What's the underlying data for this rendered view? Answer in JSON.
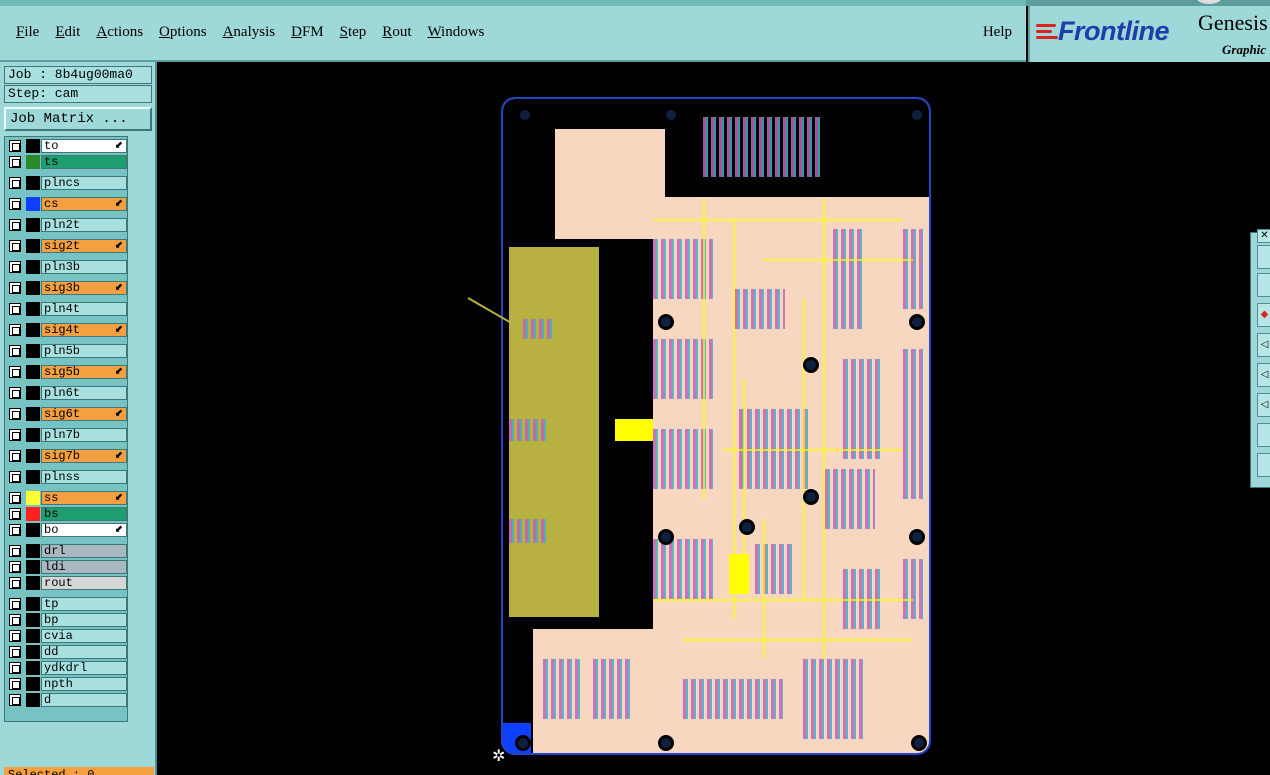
{
  "menu": {
    "items": [
      {
        "label": "File",
        "ul": "F",
        "rest": "ile"
      },
      {
        "label": "Edit",
        "ul": "E",
        "rest": "dit"
      },
      {
        "label": "Actions",
        "ul": "A",
        "rest": "ctions"
      },
      {
        "label": "Options",
        "ul": "O",
        "rest": "ptions"
      },
      {
        "label": "Analysis",
        "ul": "A",
        "rest": "nalysis"
      },
      {
        "label": "DFM",
        "ul": "D",
        "rest": "FM"
      },
      {
        "label": "Step",
        "ul": "S",
        "rest": "tep"
      },
      {
        "label": "Rout",
        "ul": "R",
        "rest": "out"
      },
      {
        "label": "Windows",
        "ul": "W",
        "rest": "indows"
      }
    ],
    "help": "Help"
  },
  "logo": {
    "brand": "Frontline",
    "product": "Genesis",
    "subtitle": "Graphic"
  },
  "job": {
    "job_label": "Job : 8b4ug00ma0",
    "step_label": "Step: cam",
    "matrix_button": "Job Matrix ..."
  },
  "layers": [
    {
      "name": "to",
      "bg": "#ffffff",
      "swatch": "#000000",
      "arrow": true
    },
    {
      "name": "ts",
      "bg": "#1f9f6f",
      "swatch": "#2a8a2a",
      "arrow": false
    },
    {
      "name": "plncs",
      "bg": "#a8e0e0",
      "swatch": "#000000",
      "arrow": false
    },
    {
      "name": "cs",
      "bg": "#f4a040",
      "swatch": "#1040ff",
      "arrow": true
    },
    {
      "name": "pln2t",
      "bg": "#a8e0e0",
      "swatch": "#000000",
      "arrow": false
    },
    {
      "name": "sig2t",
      "bg": "#f4a040",
      "swatch": "#000000",
      "arrow": true
    },
    {
      "name": "pln3b",
      "bg": "#a8e0e0",
      "swatch": "#000000",
      "arrow": false
    },
    {
      "name": "sig3b",
      "bg": "#f4a040",
      "swatch": "#000000",
      "arrow": true
    },
    {
      "name": "pln4t",
      "bg": "#a8e0e0",
      "swatch": "#000000",
      "arrow": false
    },
    {
      "name": "sig4t",
      "bg": "#f4a040",
      "swatch": "#000000",
      "arrow": true
    },
    {
      "name": "pln5b",
      "bg": "#a8e0e0",
      "swatch": "#000000",
      "arrow": false
    },
    {
      "name": "sig5b",
      "bg": "#f4a040",
      "swatch": "#000000",
      "arrow": true
    },
    {
      "name": "pln6t",
      "bg": "#a8e0e0",
      "swatch": "#000000",
      "arrow": false
    },
    {
      "name": "sig6t",
      "bg": "#f4a040",
      "swatch": "#000000",
      "arrow": true
    },
    {
      "name": "pln7b",
      "bg": "#a8e0e0",
      "swatch": "#000000",
      "arrow": false
    },
    {
      "name": "sig7b",
      "bg": "#f4a040",
      "swatch": "#000000",
      "arrow": true
    },
    {
      "name": "plnss",
      "bg": "#a8e0e0",
      "swatch": "#000000",
      "arrow": false
    },
    {
      "name": "ss",
      "bg": "#f4a040",
      "swatch": "#ffff33",
      "arrow": true
    },
    {
      "name": "bs",
      "bg": "#1f9f6f",
      "swatch": "#ff2020",
      "arrow": false
    },
    {
      "name": "bo",
      "bg": "#ffffff",
      "swatch": "#000000",
      "arrow": true
    },
    {
      "name": "drl",
      "bg": "#a9b7bf",
      "swatch": "#000000",
      "arrow": false
    },
    {
      "name": "ldi",
      "bg": "#a9b7bf",
      "swatch": "#000000",
      "arrow": false
    },
    {
      "name": "rout",
      "bg": "#d6d6d6",
      "swatch": "#000000",
      "arrow": false
    },
    {
      "name": "tp",
      "bg": "#a8e0e0",
      "swatch": "#000000",
      "arrow": false
    },
    {
      "name": "bp",
      "bg": "#a8e0e0",
      "swatch": "#000000",
      "arrow": false
    },
    {
      "name": "cvia",
      "bg": "#a8e0e0",
      "swatch": "#000000",
      "arrow": false
    },
    {
      "name": "dd",
      "bg": "#a8e0e0",
      "swatch": "#000000",
      "arrow": false
    },
    {
      "name": "ydkdrl",
      "bg": "#a8e0e0",
      "swatch": "#000000",
      "arrow": false
    },
    {
      "name": "npth",
      "bg": "#a8e0e0",
      "swatch": "#000000",
      "arrow": false
    },
    {
      "name": "d",
      "bg": "#a8e0e0",
      "swatch": "#000000",
      "arrow": false
    }
  ],
  "status": {
    "selected": "Selected : 0"
  },
  "colors": {
    "panel": "#9fd8d8",
    "board_fill": "#f7d7c0",
    "board_outline": "#2244cc",
    "copper_pad": "#c060c0",
    "trace": "#ffff00",
    "olive_area": "#b8b040"
  }
}
